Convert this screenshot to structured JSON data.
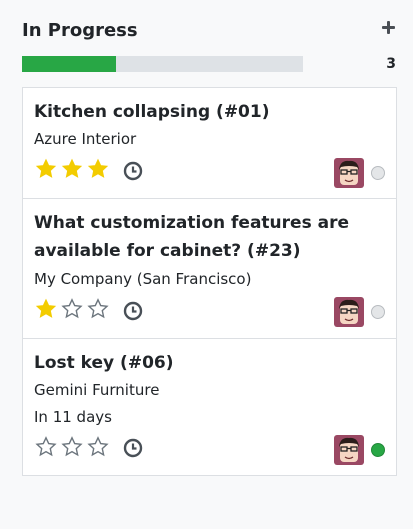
{
  "column": {
    "title": "In Progress",
    "count": "3",
    "progress_fraction": 0.335,
    "progress_color": "#28a745",
    "add_icon": "plus-icon"
  },
  "cards": [
    {
      "title": "Kitchen collapsing (#01)",
      "customer": "Azure Interior",
      "deadline": "",
      "stars": 3,
      "status_color": "#e4e6e8"
    },
    {
      "title": "What customization features are available for cabinet? (#23)",
      "customer": "My Company (San Francisco)",
      "deadline": "",
      "stars": 1,
      "status_color": "#e4e6e8"
    },
    {
      "title": "Lost key (#06)",
      "customer": "Gemini Furniture",
      "deadline": "In 11 days",
      "stars": 0,
      "status_color": "#28a745"
    }
  ],
  "colors": {
    "star_filled": "#f3cc00",
    "star_empty": "#6c757d",
    "progress_track": "#dee2e6"
  },
  "icons": [
    "plus-icon",
    "star-icon",
    "clock-icon",
    "avatar",
    "status-dot"
  ]
}
